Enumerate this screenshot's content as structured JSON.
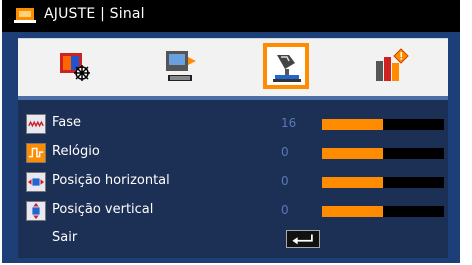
{
  "title": "AJUSTE | Sinal",
  "tabs": [
    {
      "icon": "color-setting-icon"
    },
    {
      "icon": "display-setting-icon"
    },
    {
      "icon": "signal-setting-icon",
      "selected": true
    },
    {
      "icon": "info-setting-icon"
    }
  ],
  "items": [
    {
      "label": "Fase",
      "value": "16",
      "level": 0.5,
      "icon": "phase-icon"
    },
    {
      "label": "Relógio",
      "value": "0",
      "level": 0.5,
      "icon": "clock-icon"
    },
    {
      "label": "Posição horizontal",
      "value": "0",
      "level": 0.5,
      "icon": "horizontal-position-icon"
    },
    {
      "label": "Posição vertical",
      "value": "0",
      "level": 0.5,
      "icon": "vertical-position-icon"
    }
  ],
  "exit_label": "Sair",
  "colors": {
    "accent": "#ff8c00",
    "frame": "#1c3f78",
    "menu_bg": "#1c2f55",
    "value_text": "#5a78b8"
  }
}
